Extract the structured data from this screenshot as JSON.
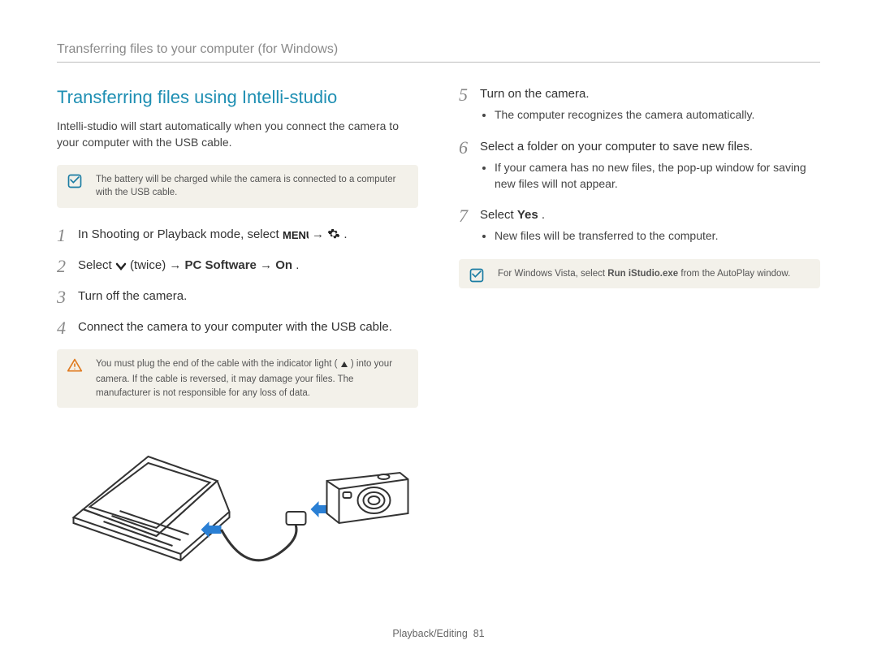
{
  "header": {
    "running_title": "Transferring files to your computer (for Windows)"
  },
  "left": {
    "section_title": "Transferring files using Intelli-studio",
    "intro": "Intelli-studio will start automatically when you connect the camera to your computer with the USB cable.",
    "info_note": "The battery will be charged while the camera is connected to a computer with the USB cable.",
    "step1_prefix": "In Shooting or Playback mode, select ",
    "step1_after": " .",
    "step2_prefix": "Select ",
    "step2_mid": " (twice) → ",
    "step2_bold1": "PC Software",
    "step2_arrow2": " → ",
    "step2_bold2": "On",
    "step2_suffix": ".",
    "step3": "Turn off the camera.",
    "step4": "Connect the camera to your computer with the USB cable.",
    "warn_prefix": "You must plug the end of the cable with the indicator light (",
    "warn_suffix": ") into your camera. If the cable is reversed, it may damage your files. The manufacturer is not responsible for any loss of data."
  },
  "right": {
    "step5": "Turn on the camera.",
    "step5_sub": "The computer recognizes the camera automatically.",
    "step6": "Select a folder on your computer to save new files.",
    "step6_sub": "If your camera has no new files, the pop-up window for saving new files will not appear.",
    "step7_prefix": "Select ",
    "step7_bold": "Yes",
    "step7_suffix": ".",
    "step7_sub": "New files will be transferred to the computer.",
    "vista_prefix": "For Windows Vista, select ",
    "vista_bold": "Run iStudio.exe",
    "vista_suffix": " from the AutoPlay window."
  },
  "footer": {
    "section": "Playback/Editing",
    "page": "81"
  }
}
